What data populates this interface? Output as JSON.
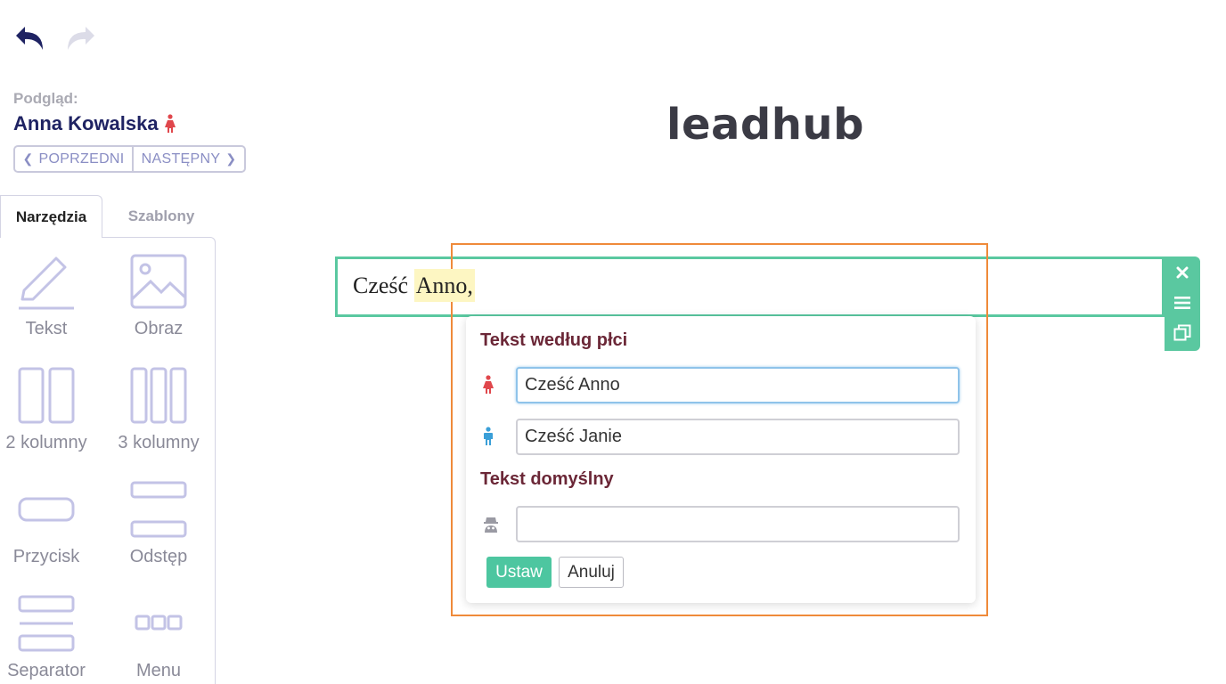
{
  "toolbar": {
    "undo_icon": "undo-arrow",
    "redo_icon": "redo-arrow"
  },
  "preview": {
    "label": "Podgląd:",
    "name": "Anna Kowalska",
    "gender_icon": "female",
    "prev_label": "POPRZEDNI",
    "next_label": "NASTĘPNY"
  },
  "tabs": [
    {
      "label": "Narzędzia",
      "active": true
    },
    {
      "label": "Szablony",
      "active": false
    }
  ],
  "tools": [
    {
      "label": "Tekst",
      "icon": "pencil"
    },
    {
      "label": "Obraz",
      "icon": "image"
    },
    {
      "label": "2 kolumny",
      "icon": "two-columns"
    },
    {
      "label": "3 kolumny",
      "icon": "three-columns"
    },
    {
      "label": "Przycisk",
      "icon": "button"
    },
    {
      "label": "Odstęp",
      "icon": "spacer"
    },
    {
      "label": "Separator",
      "icon": "separator"
    },
    {
      "label": "Menu",
      "icon": "menu"
    }
  ],
  "logo": {
    "text": "leadhub"
  },
  "editor": {
    "greeting_prefix": "Cześć",
    "greeting_highlight": "Anno,",
    "block_border_color": "#5ac8a0",
    "selection_border_color": "#ef8a3a"
  },
  "popup": {
    "gender_title": "Tekst według płci",
    "female_value": "Cześć Anno",
    "male_value": "Cześć Janie",
    "default_title": "Tekst domyślny",
    "default_value": "",
    "set_label": "Ustaw",
    "cancel_label": "Anuluj"
  },
  "colors": {
    "accent_green": "#4dc6a0",
    "title_maroon": "#6b2737",
    "female": "#e0474c",
    "male": "#3a9fd8",
    "navy": "#1f2363"
  }
}
